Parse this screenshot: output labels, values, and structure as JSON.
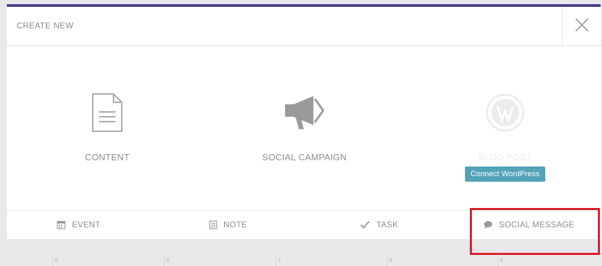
{
  "modal": {
    "title": "CREATE NEW",
    "close_icon": "close-icon"
  },
  "options": {
    "content": {
      "label": "CONTENT",
      "icon": "document-icon"
    },
    "social_campaign": {
      "label": "SOCIAL CAMPAIGN",
      "icon": "megaphone-icon"
    },
    "blog_post": {
      "label": "BLOG POST",
      "icon": "wordpress-icon",
      "button": "Connect WordPress"
    }
  },
  "quick_options": {
    "event": {
      "label": "EVENT",
      "icon": "calendar-icon"
    },
    "note": {
      "label": "NOTE",
      "icon": "note-icon"
    },
    "task": {
      "label": "TASK",
      "icon": "checkmark-icon"
    },
    "social_message": {
      "label": "SOCIAL MESSAGE",
      "icon": "speech-bubble-icon"
    }
  },
  "calendar": {
    "days": [
      "5",
      "6",
      "7",
      "8",
      "9"
    ]
  },
  "colors": {
    "header_accent": "#4b3f8a",
    "connect_button": "#52a3b8",
    "highlight": "#d81f26"
  }
}
